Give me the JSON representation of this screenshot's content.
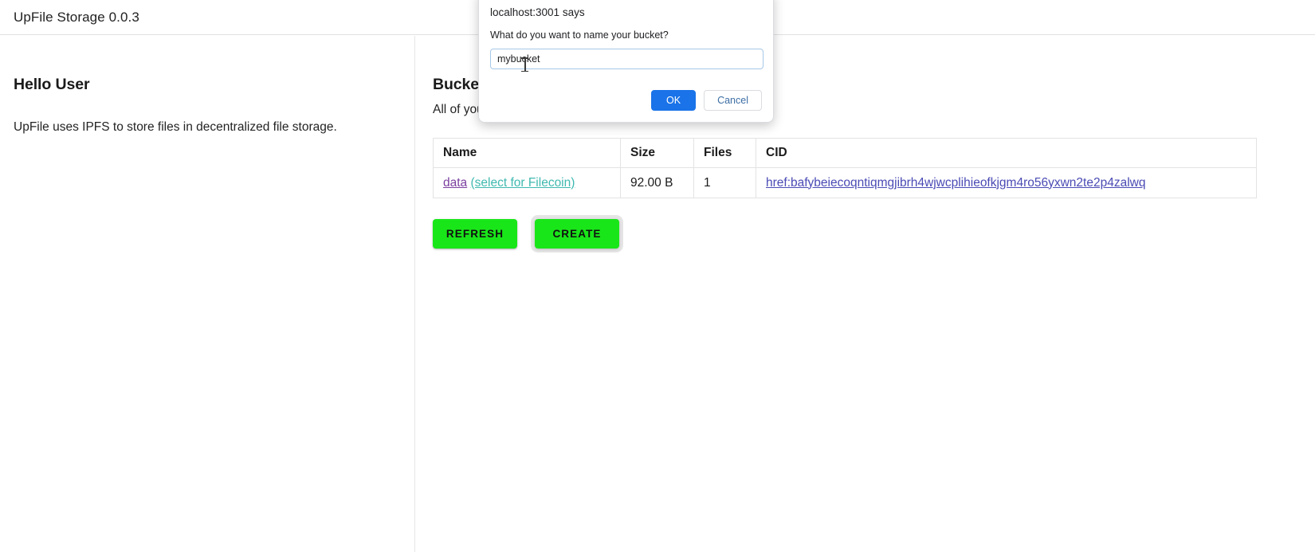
{
  "header": {
    "title": "UpFile Storage 0.0.3"
  },
  "left": {
    "heading": "Hello User",
    "description": "UpFile uses IPFS to store files in decentralized file storage."
  },
  "buckets": {
    "heading": "Buckets",
    "subtitle": "All of your buckets",
    "columns": [
      "Name",
      "Size",
      "Files",
      "CID"
    ],
    "rows": [
      {
        "name": "data",
        "select_label": "(select for Filecoin)",
        "size": "92.00 B",
        "files": "1",
        "cid": "href:bafybeiecoqntiqmgjibrh4wjwcplihieofkjgm4ro56yxwn2te2p4zalwq"
      }
    ],
    "refresh_label": "REFRESH",
    "create_label": "CREATE"
  },
  "dialog": {
    "origin": "localhost:3001 says",
    "message": "What do you want to name your bucket?",
    "input_value": "mybucket",
    "input_placeholder": "",
    "ok_label": "OK",
    "cancel_label": "Cancel"
  },
  "colors": {
    "green_button": "#19e619",
    "dialog_primary": "#1a73e8",
    "link_visited": "#7b3fa0",
    "link_teal": "#3fb9b0",
    "link_cid": "#4a4ab5"
  }
}
